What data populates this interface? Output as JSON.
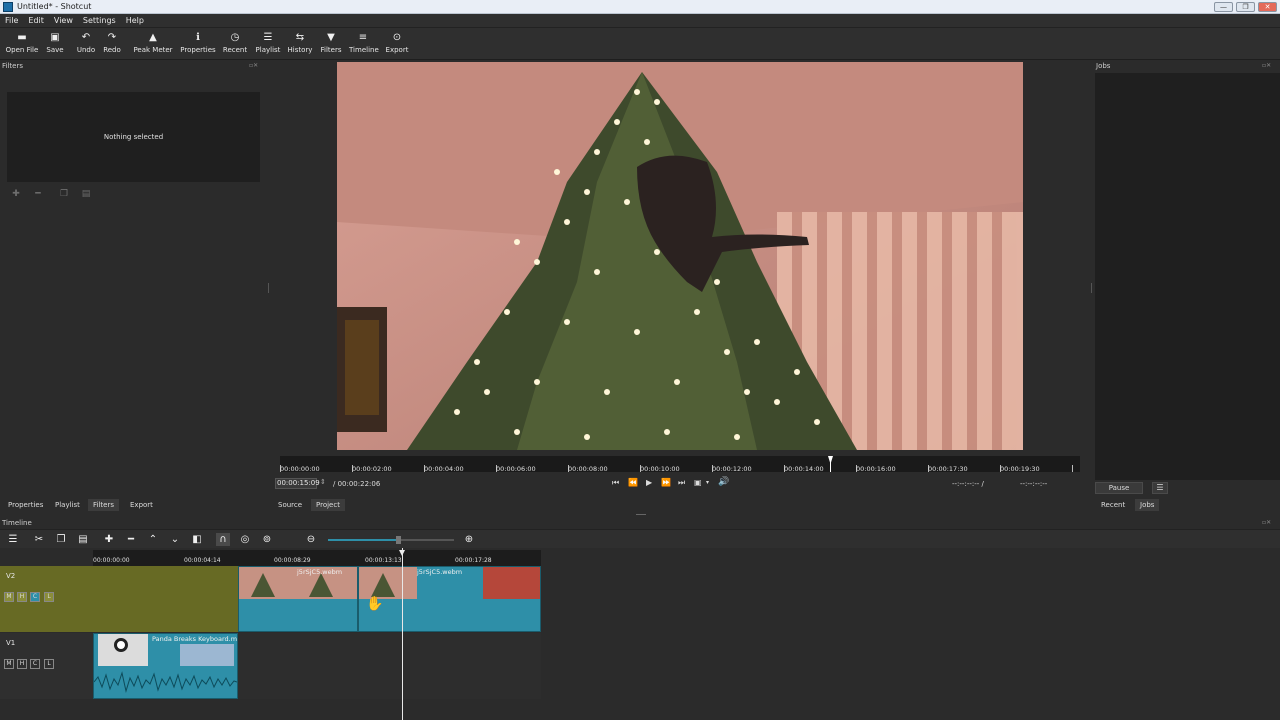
{
  "window": {
    "title": "Untitled* - Shotcut",
    "controls": [
      "—",
      "❐",
      "✕"
    ]
  },
  "menu": [
    "File",
    "Edit",
    "View",
    "Settings",
    "Help"
  ],
  "toolbar": [
    {
      "label": "Open File",
      "icon": "open-file-icon",
      "glyph": "▬"
    },
    {
      "label": "Save",
      "icon": "save-icon",
      "glyph": "▣"
    },
    {
      "label": "Undo",
      "icon": "undo-icon",
      "glyph": "↶"
    },
    {
      "label": "Redo",
      "icon": "redo-icon",
      "glyph": "↷"
    },
    {
      "label": "Peak Meter",
      "icon": "peak-meter-icon",
      "glyph": "▲"
    },
    {
      "label": "Properties",
      "icon": "info-icon",
      "glyph": "ℹ"
    },
    {
      "label": "Recent",
      "icon": "clock-icon",
      "glyph": "◷"
    },
    {
      "label": "Playlist",
      "icon": "list-icon",
      "glyph": "☰"
    },
    {
      "label": "History",
      "icon": "history-icon",
      "glyph": "⇆"
    },
    {
      "label": "Filters",
      "icon": "filter-icon",
      "glyph": "▼"
    },
    {
      "label": "Timeline",
      "icon": "timeline-icon",
      "glyph": "≡"
    },
    {
      "label": "Export",
      "icon": "export-icon",
      "glyph": "⊙"
    }
  ],
  "filters_panel": {
    "title": "Filters",
    "message": "Nothing selected"
  },
  "jobs_panel": {
    "title": "Jobs",
    "pause_label": "Pause"
  },
  "player": {
    "ruler_ticks": [
      "00:00:00:00",
      "00:00:02:00",
      "00:00:04:00",
      "00:00:06:00",
      "00:00:08:00",
      "00:00:10:00",
      "00:00:12:00",
      "00:00:14:00",
      "00:00:16:00",
      "00:00:17:30",
      "00:00:19:30"
    ],
    "current_time": "00:00:15:09",
    "duration": "/ 00:00:22:06",
    "in_point": "--:--:--:-- /",
    "out_point": "--:--:--:--"
  },
  "bottom_tabs_left": [
    "Properties",
    "Playlist",
    "Filters",
    "Export"
  ],
  "player_tabs": [
    "Source",
    "Project"
  ],
  "right_tabs": [
    "Recent",
    "Jobs"
  ],
  "timeline": {
    "title": "Timeline",
    "ruler_ticks": [
      "00:00:00:00",
      "00:00:04:14",
      "00:00:08:29",
      "00:00:13:13",
      "00:00:17:28"
    ],
    "tracks": [
      {
        "name": "V2",
        "buttons": [
          "M",
          "H",
          "C",
          "L"
        ]
      },
      {
        "name": "V1",
        "buttons": [
          "M",
          "H",
          "C",
          "L"
        ]
      }
    ],
    "clips": [
      {
        "label": "j5rSjC5.webm"
      },
      {
        "label": "j5rSjC5.webm"
      },
      {
        "label": "Panda Breaks Keyboard.m"
      }
    ]
  },
  "colors": {
    "track_v2": "#676a24",
    "clip": "#2e8fa8",
    "background": "#2b2b2b"
  }
}
